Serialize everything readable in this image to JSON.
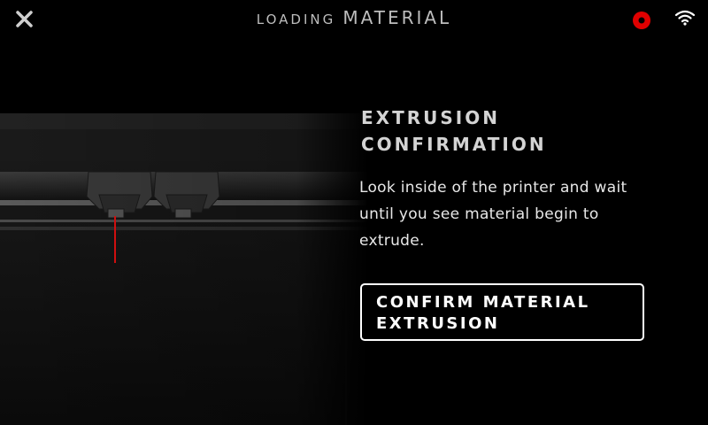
{
  "header": {
    "title_prefix": "LOADING",
    "title_main": "MATERIAL",
    "close_icon": "close-icon",
    "status_icon": "record-status-icon",
    "status_color": "#e00000",
    "wifi_icon": "wifi-icon"
  },
  "main": {
    "heading_lines": [
      "EXTRUSION",
      "CONFIRMATION"
    ],
    "body_lines": [
      "Look inside of the printer and wait",
      "until you see material begin to",
      "extrude."
    ],
    "confirm_button_lines": [
      "CONFIRM MATERIAL",
      "EXTRUSION"
    ],
    "indicator_color": "#e01010"
  }
}
